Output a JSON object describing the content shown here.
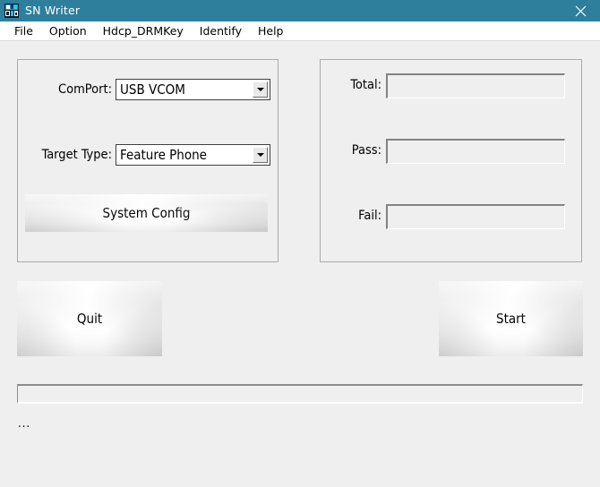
{
  "window": {
    "title": "SN Writer",
    "icon": "app-icon",
    "close_label": "×",
    "titlebar_color": "#2e7f9c",
    "body_color": "#efefef"
  },
  "menubar": {
    "items": [
      {
        "label": "File"
      },
      {
        "label": "Option"
      },
      {
        "label": "Hdcp_DRMKey"
      },
      {
        "label": "Identify"
      },
      {
        "label": "Help"
      }
    ]
  },
  "config_panel": {
    "comport": {
      "label": "ComPort:",
      "value": "USB VCOM"
    },
    "target_type": {
      "label": "Target Type:",
      "value": "Feature Phone"
    },
    "system_config_button": "System Config"
  },
  "counters_panel": {
    "total": {
      "label": "Total:",
      "value": ""
    },
    "pass": {
      "label": "Pass:",
      "value": ""
    },
    "fail": {
      "label": "Fail:",
      "value": ""
    }
  },
  "actions": {
    "quit": "Quit",
    "start": "Start"
  },
  "progress": {
    "percent": 0,
    "fill_color": "#06b025"
  },
  "status": {
    "text": "..."
  }
}
